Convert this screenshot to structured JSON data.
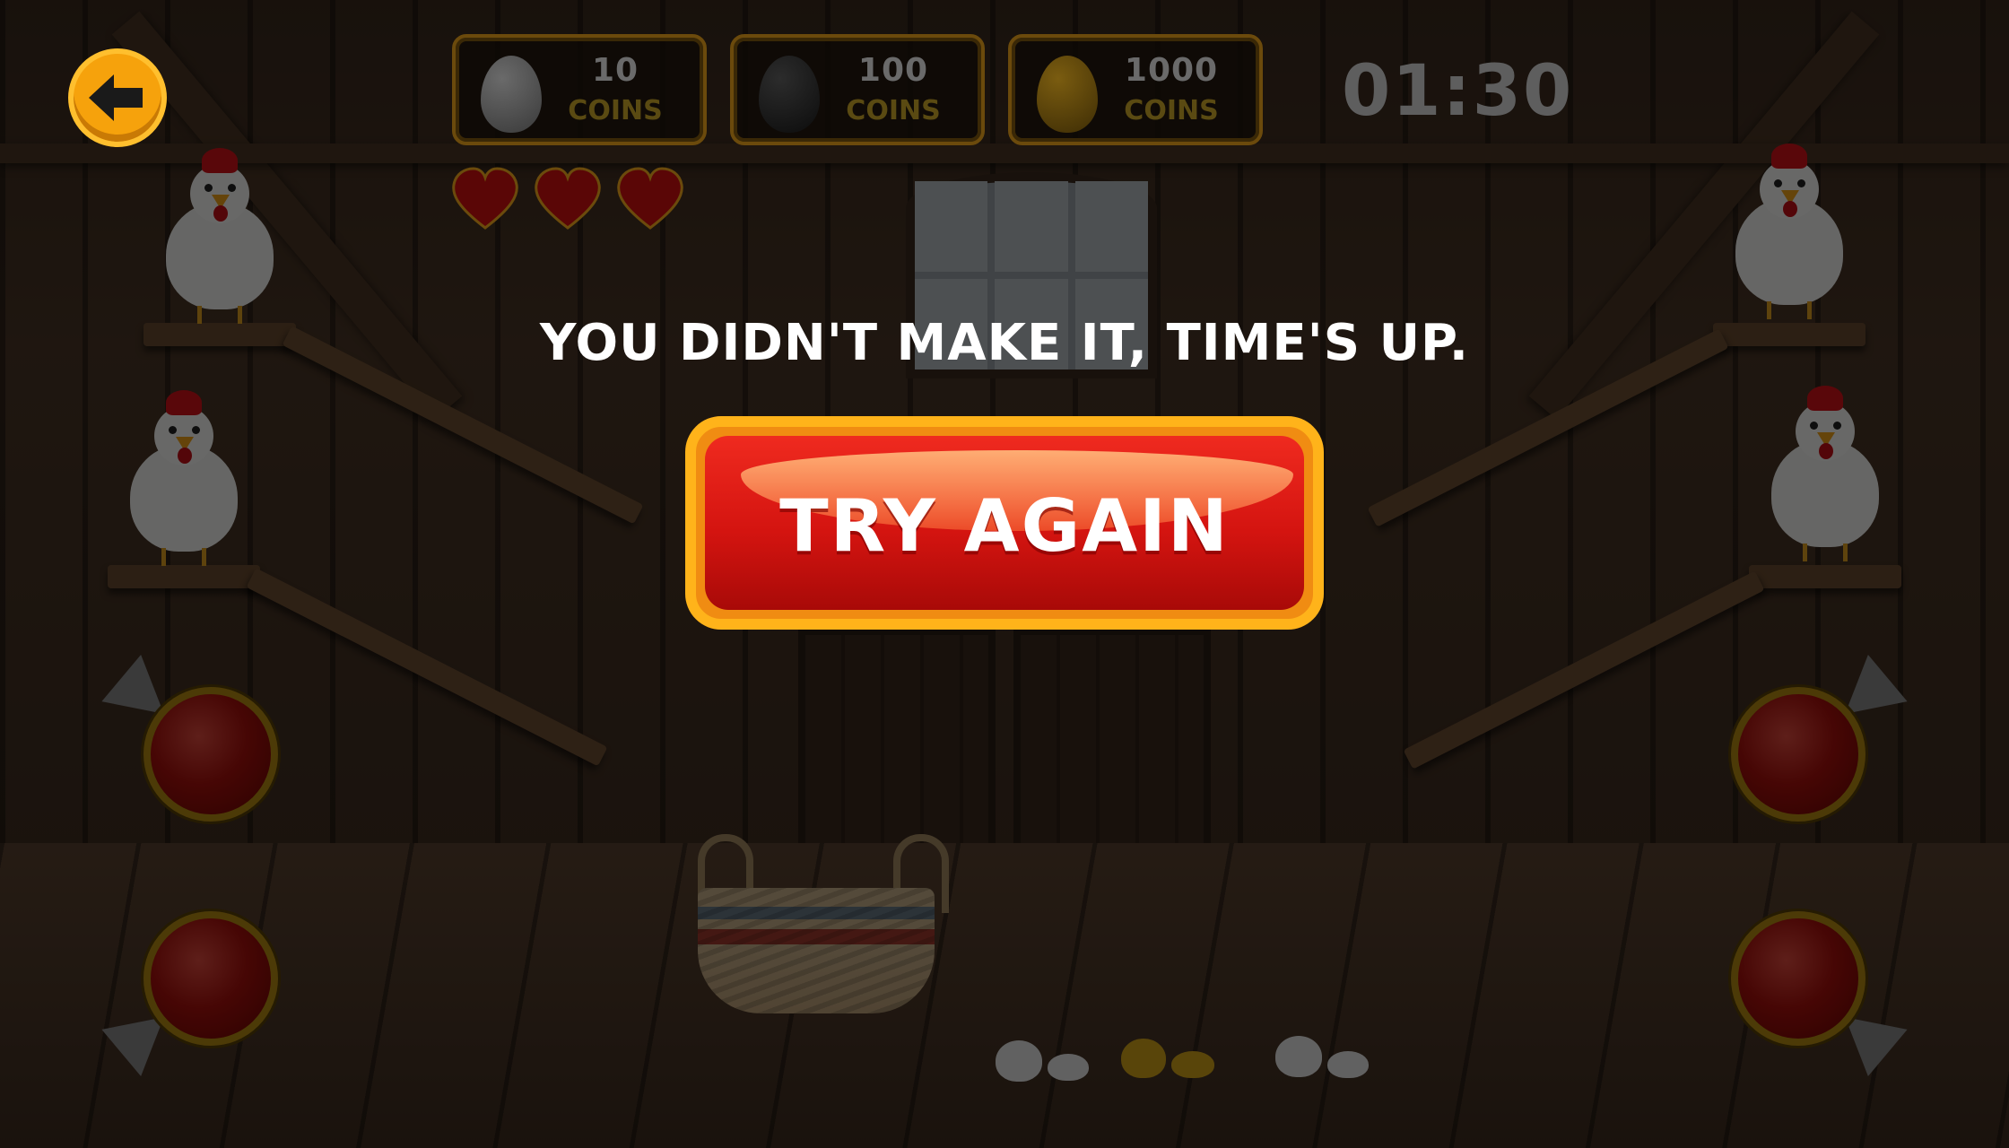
{
  "hud": {
    "coin_boxes": [
      {
        "amount": "10",
        "unit": "COINS",
        "egg_color": "#d9d9d9"
      },
      {
        "amount": "100",
        "unit": "COINS",
        "egg_color": "#2a2a2a"
      },
      {
        "amount": "1000",
        "unit": "COINS",
        "egg_color": "#d4a418"
      }
    ],
    "timer": "01:30",
    "lives": 3
  },
  "message": "YOU DIDN'T MAKE IT, TIME'S UP.",
  "try_again_label": "TRY AGAIN",
  "colors": {
    "accent_orange": "#f6a20c",
    "button_red": "#d41410",
    "heart_red": "#c81010"
  }
}
